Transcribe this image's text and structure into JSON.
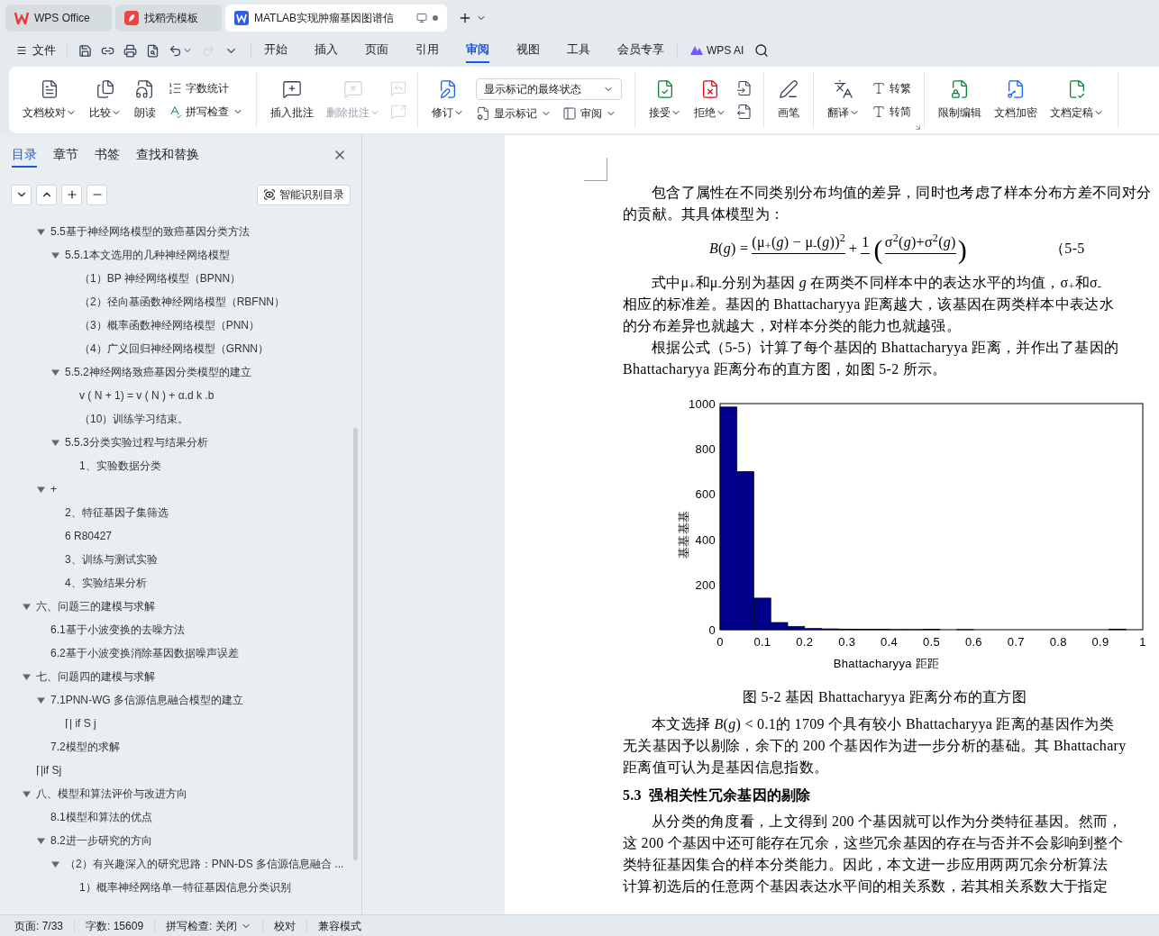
{
  "window_tabs": [
    {
      "kind": "wps",
      "label": "WPS Office",
      "selected": false
    },
    {
      "kind": "docer",
      "label": "找稻壳模板",
      "selected": false
    },
    {
      "kind": "doc",
      "label": "MATLAB实现肿瘤基因图谱信",
      "selected": true
    }
  ],
  "menu": {
    "file": "文件",
    "quick_tools": [
      {
        "kind": "save",
        "disabled": false,
        "dropdown": false
      },
      {
        "kind": "share",
        "disabled": false,
        "dropdown": false
      },
      {
        "kind": "print",
        "disabled": false,
        "dropdown": false
      },
      {
        "kind": "preview",
        "disabled": false,
        "dropdown": false
      },
      {
        "kind": "undo",
        "disabled": false,
        "dropdown": true
      },
      {
        "kind": "redo",
        "disabled": true,
        "dropdown": false
      },
      {
        "kind": "more",
        "disabled": false,
        "dropdown": false
      }
    ],
    "tabs": [
      {
        "label": "开始",
        "selected": false
      },
      {
        "label": "插入",
        "selected": false
      },
      {
        "label": "页面",
        "selected": false
      },
      {
        "label": "引用",
        "selected": false
      },
      {
        "label": "审阅",
        "selected": true
      },
      {
        "label": "视图",
        "selected": false
      },
      {
        "label": "工具",
        "selected": false
      },
      {
        "label": "会员专享",
        "selected": false
      }
    ],
    "ai": "WPS AI"
  },
  "ribbon": [
    [
      {
        "kind": "large",
        "label": "文档校对",
        "dropdown": true,
        "disabled": false
      },
      {
        "kind": "large",
        "label": "比较",
        "dropdown": true,
        "disabled": false
      },
      {
        "kind": "large",
        "label": "朗读",
        "dropdown": false,
        "disabled": false
      },
      {
        "kind": "stack",
        "rows": [
          {
            "label": "字数统计",
            "dropdown": false
          },
          {
            "label": "拼写检查",
            "dropdown": true
          }
        ]
      }
    ],
    [
      {
        "kind": "large",
        "label": "插入批注",
        "dropdown": false,
        "disabled": false
      },
      {
        "kind": "large",
        "label": "删除批注",
        "dropdown": true,
        "disabled": true
      },
      {
        "kind": "icons",
        "rows": [
          {
            "disabled": true
          },
          {
            "disabled": true
          }
        ]
      }
    ],
    [
      {
        "kind": "large",
        "label": "修订",
        "dropdown": true,
        "disabled": false
      },
      {
        "kind": "review",
        "select": "显示标记的最终状态",
        "rows": [
          {
            "label": "显示标记",
            "dropdown": true
          },
          {
            "label": "审阅",
            "dropdown": true
          }
        ]
      }
    ],
    [
      {
        "kind": "large",
        "label": "接受",
        "dropdown": true,
        "disabled": false
      },
      {
        "kind": "large",
        "label": "拒绝",
        "dropdown": true,
        "disabled": false
      },
      {
        "kind": "icons",
        "rows": [
          {
            "disabled": false
          },
          {
            "disabled": false
          }
        ]
      }
    ],
    [
      {
        "kind": "large",
        "label": "画笔",
        "dropdown": false,
        "disabled": false
      }
    ],
    [
      {
        "kind": "large",
        "label": "翻译",
        "dropdown": true,
        "disabled": false
      },
      {
        "kind": "stack",
        "rows": [
          {
            "label": "转繁",
            "dropdown": false
          },
          {
            "label": "转简",
            "dropdown": false
          }
        ]
      }
    ],
    [
      {
        "kind": "large",
        "label": "限制编辑",
        "dropdown": false,
        "disabled": false
      },
      {
        "kind": "large",
        "label": "文档加密",
        "dropdown": false,
        "disabled": false
      },
      {
        "kind": "large",
        "label": "文档定稿",
        "dropdown": true,
        "disabled": false
      }
    ]
  ],
  "sidebar": {
    "tabs": [
      {
        "label": "目录",
        "selected": true
      },
      {
        "label": "章节",
        "selected": false
      },
      {
        "label": "书签",
        "selected": false
      },
      {
        "label": "查找和替换",
        "selected": false
      }
    ],
    "smart_button": "智能识别目录",
    "toc": {
      "continued": [
        {
          "text": "5.5基于神经网络模型的致癌基因分类方法",
          "expanded": true,
          "children": [
            {
              "text": "5.5.1本文选用的几种神经网络模型",
              "expanded": true,
              "children": [
                {
                  "text": "（1）BP 神经网络模型（BPNN）"
                },
                {
                  "text": "（2）径向基函数神经网络模型（RBFNN）"
                },
                {
                  "text": "（3）概率函数神经网络模型（PNN）"
                },
                {
                  "text": "（4）广义回归神经网络模型（GRNN）"
                }
              ]
            },
            {
              "text": "5.5.2神经网络致癌基因分类模型的建立",
              "expanded": true,
              "children": [
                {
                  "text": "v ( N + 1) = v ( N ) + α.d k .b"
                },
                {
                  "text": "（10）训练学习结束。"
                }
              ]
            },
            {
              "text": "5.5.3分类实验过程与结果分析",
              "expanded": true,
              "children": [
                {
                  "text": "1、实验数据分类"
                }
              ]
            }
          ]
        },
        {
          "text": "+",
          "expanded": true,
          "children": [
            {
              "text": "2、特征基因子集筛选"
            },
            {
              "text": "6 R80427"
            },
            {
              "text": "3、训练与测试实验"
            },
            {
              "text": "4、实验结果分析"
            }
          ]
        }
      ],
      "items": [
        {
          "text": "六、问题三的建模与求解",
          "expanded": true,
          "children": [
            {
              "text": "6.1基于小波变换的去噪方法"
            },
            {
              "text": "6.2基于小波变换消除基因数据噪声误差"
            }
          ]
        },
        {
          "text": "七、问题四的建模与求解",
          "expanded": true,
          "children": [
            {
              "text": "7.1PNN-WG 多信源信息融合模型的建立",
              "expanded": true,
              "children": [
                {
                  "text": "⌈| if S j"
                }
              ]
            },
            {
              "text": "7.2模型的求解"
            }
          ]
        },
        {
          "text": "⌈|if Sj"
        },
        {
          "text": "八、模型和算法评价与改进方向",
          "expanded": true,
          "children": [
            {
              "text": "8.1模型和算法的优点"
            },
            {
              "text": "8.2进一步研究的方向",
              "expanded": true,
              "children": [
                {
                  "text": "（2）有兴趣深入的研究思路：PNN-DS 多信源信息融合 ...",
                  "expanded": true,
                  "children": [
                    {
                      "text": "1）概率神经网络单一特征基因信息分类识别"
                    }
                  ]
                }
              ]
            }
          ]
        }
      ]
    }
  },
  "document": {
    "intro": {
      "lines": [
        "包含了属性在不同类别分布均值的差异，同时也考虑了样本分布方差不同对分",
        "的贡献。其具体模型为："
      ]
    },
    "formula": {
      "lhs": "*B*(*g*) =",
      "numerator": "(μ$_{+}$(*g*) − μ$_{-}$(*g*))$^{2}$",
      "plus": "+",
      "half": "1",
      "open": "(",
      "close": ")",
      "inner": "σ$^{2}$(*g*)+σ$^{2}$(*g*)",
      "number": "（5-5"
    },
    "paragraphs_before": [
      {
        "lines": [
          "式中μ$_{+}$和μ$_{-}$分别为基因 *g* 在两类不同样本中的表达水平的均值，σ$_{+}$和σ$_{-}$",
          "相应的标准差。基因的 Bhattacharyya 距离越大，该基因在两类样本中表达水",
          "的分布差异也就越大，对样本分类的能力也就越强。"
        ]
      },
      {
        "lines": [
          "根据公式（5-5）计算了每个基因的 Bhattacharyya 距离，并作出了基因的",
          "Bhattacharyya 距离分布的直方图，如图 5-2 所示。"
        ]
      }
    ],
    "chart_data": {
      "type": "bar",
      "xlabel": "Bhattacharyya 距距",
      "ylabel": "基基基基",
      "x": [
        0.02,
        0.06,
        0.1,
        0.14,
        0.18,
        0.22,
        0.26,
        0.3,
        0.34,
        0.38,
        0.42,
        0.46,
        0.5,
        0.54,
        0.58,
        0.62,
        0.66,
        0.7,
        0.74,
        0.78,
        0.82,
        0.86,
        0.9,
        0.94,
        0.98
      ],
      "values": [
        985,
        700,
        140,
        32,
        15,
        6,
        4,
        3,
        2,
        2,
        1,
        1,
        2,
        0,
        1,
        0,
        0,
        0,
        0,
        0,
        0,
        0,
        0,
        3,
        0
      ],
      "xlim": [
        0,
        1
      ],
      "ylim": [
        0,
        1000
      ],
      "xticks": [
        0,
        0.1,
        0.2,
        0.3,
        0.4,
        0.5,
        0.6,
        0.7,
        0.8,
        0.9,
        1
      ],
      "yticks": [
        0,
        200,
        400,
        600,
        800,
        1000
      ]
    },
    "caption": "图 5-2  基因 Bhattacharyya 距离分布的直方图",
    "paragraphs_after": [
      {
        "lines": [
          "本文选择 *B*(*g*) < 0.1的 1709 个具有较小 Bhattacharyya 距离的基因作为类",
          "无关基因予以剔除，余下的 200 个基因作为进一步分析的基础。其 Bhattachary",
          "距离值可认为是基因信息指数。"
        ]
      }
    ],
    "heading": "5.3  强相关性冗余基因的剔除",
    "paragraphs_end": [
      {
        "lines": [
          "从分类的角度看，上文得到 200 个基因就可以作为分类特征基因。然而，",
          "这 200 个基因中还可能存在冗余，这些冗余基因的存在与否并不会影响到整个",
          "类特征基因集合的样本分类能力。因此，本文进一步应用两两冗余分析算法",
          "计算初选后的任意两个基因表达水平间的相关系数，若其相关系数大于指定"
        ]
      }
    ]
  },
  "status_bar": [
    {
      "text": "页面: 7/33",
      "dropdown": false
    },
    {
      "text": "字数: 15609",
      "dropdown": false
    },
    {
      "text": "拼写检查: 关闭",
      "dropdown": true
    },
    {
      "text": "校对",
      "dropdown": false
    },
    {
      "text": "兼容模式",
      "dropdown": false
    }
  ]
}
